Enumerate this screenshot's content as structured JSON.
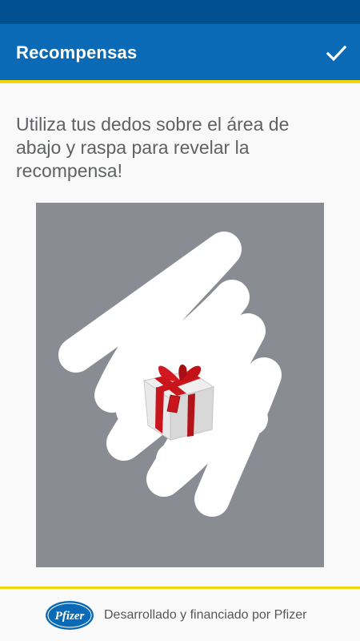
{
  "app_bar": {
    "title": "Recompensas",
    "confirm_icon": "checkmark-icon"
  },
  "instructions": "Utiliza tus dedos sobre el área de abajo y raspa para revelar la recompensa!",
  "scratch_card": {
    "reward_icon": "gift-box-icon"
  },
  "footer": {
    "logo_text": "Pfizer",
    "text": "Desarrollado y financiado por Pfizer"
  },
  "colors": {
    "status_bar": "#004f8f",
    "app_bar": "#0a6ab5",
    "accent_yellow": "#f4d60a",
    "scratch_cover": "#898c93",
    "gift_ribbon": "#c9151c"
  }
}
